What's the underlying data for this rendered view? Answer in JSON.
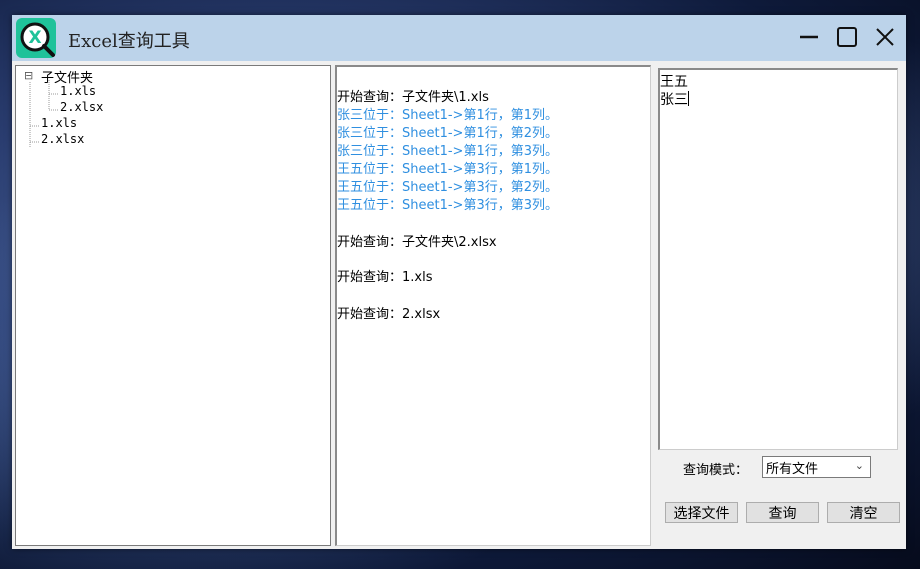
{
  "window": {
    "title": "Excel查询工具"
  },
  "titlebar_controls": [
    "minimize-icon",
    "maximize-icon",
    "close-icon"
  ],
  "tree": {
    "root_folder": "子文件夹",
    "folder_children": [
      "1.xls",
      "2.xlsx"
    ],
    "root_files": [
      "1.xls",
      "2.xlsx"
    ],
    "expander": "⊟"
  },
  "log": {
    "lines": [
      {
        "type": "head",
        "text": "开始查询：子文件夹\\1.xls"
      },
      {
        "type": "hit",
        "text": "张三位于：Sheet1->第1行，第1列。"
      },
      {
        "type": "hit",
        "text": "张三位于：Sheet1->第1行，第2列。"
      },
      {
        "type": "hit",
        "text": "张三位于：Sheet1->第1行，第3列。"
      },
      {
        "type": "hit",
        "text": "王五位于：Sheet1->第3行，第1列。"
      },
      {
        "type": "hit",
        "text": "王五位于：Sheet1->第3行，第2列。"
      },
      {
        "type": "hit",
        "text": "王五位于：Sheet1->第3行，第3列。"
      },
      {
        "type": "head",
        "text": "开始查询：子文件夹\\2.xlsx"
      },
      {
        "type": "head",
        "text": "开始查询：1.xls"
      },
      {
        "type": "head",
        "text": "开始查询：2.xlsx"
      }
    ]
  },
  "names": {
    "lines": [
      "王五",
      "张三"
    ]
  },
  "mode": {
    "label": "查询模式：",
    "selected": "所有文件"
  },
  "buttons": {
    "choose_file": "选择文件",
    "query": "查询",
    "clear": "清空"
  },
  "colors": {
    "titlebar": "#bcd3ea",
    "hit_text": "#2f8fe0",
    "icon_bg": "#1fc29a"
  }
}
